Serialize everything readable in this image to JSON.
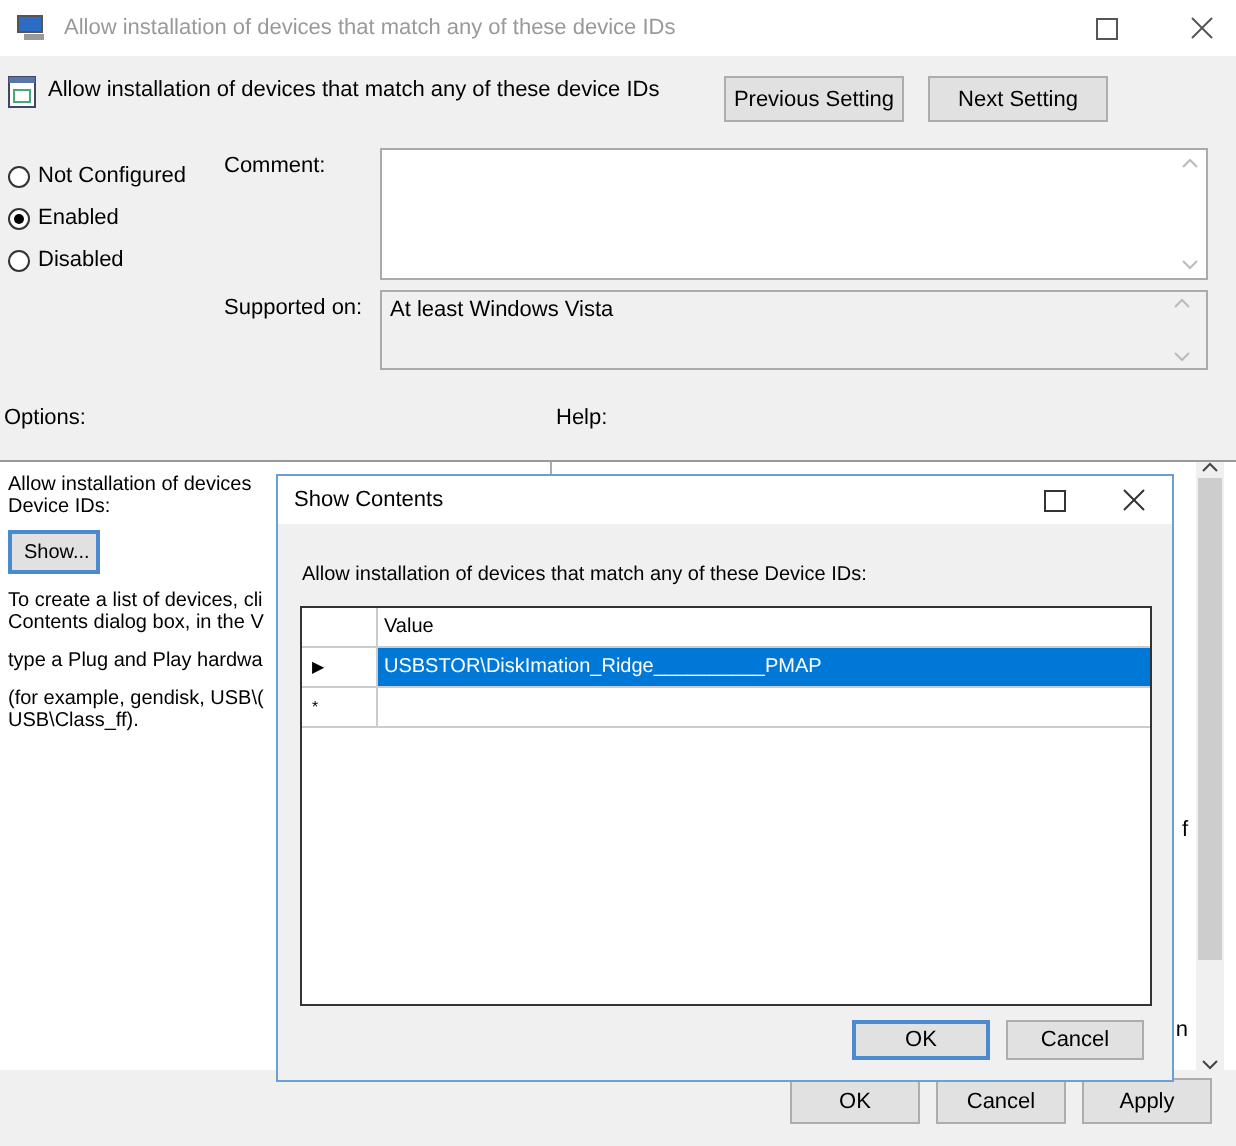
{
  "window": {
    "title": "Allow installation of devices that match any of these device IDs"
  },
  "header": {
    "title": "Allow installation of devices that match any of these device IDs",
    "buttons": [
      "Previous Setting",
      "Next Setting"
    ]
  },
  "states": [
    {
      "label": "Not Configured",
      "selected": false
    },
    {
      "label": "Enabled",
      "selected": true
    },
    {
      "label": "Disabled",
      "selected": false
    }
  ],
  "comment": {
    "label": "Comment:"
  },
  "supported": {
    "label": "Supported on:",
    "value": "At least Windows Vista"
  },
  "options_label": "Options:",
  "help_label": "Help:",
  "options": {
    "lines": [
      "Allow installation of devices",
      "Device IDs:"
    ],
    "show_button": "Show...",
    "paragraphs": [
      [
        "To create a list of devices, cli",
        "Contents dialog box, in the V"
      ],
      [
        "type a Plug and Play hardwa"
      ],
      [
        "(for example, gendisk, USB\\(",
        "USB\\Class_ff)."
      ]
    ]
  },
  "help": {
    "fragments": [
      "f",
      "n"
    ]
  },
  "dialog": {
    "title": "Show Contents",
    "prompt": "Allow installation of devices that match any of these Device IDs:",
    "column": "Value",
    "rows": [
      {
        "marker": "▶",
        "value": "USBSTOR\\DiskImation_Ridge__________PMAP",
        "selected": true
      },
      {
        "marker": "*",
        "value": "",
        "selected": false
      }
    ],
    "buttons": [
      "OK",
      "Cancel"
    ]
  },
  "buttons": [
    "OK",
    "Cancel",
    "Apply"
  ]
}
